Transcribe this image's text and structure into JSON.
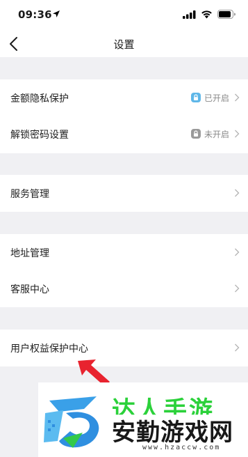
{
  "status_bar": {
    "time": "09:36"
  },
  "nav": {
    "title": "设置"
  },
  "settings": {
    "privacy": {
      "label": "金额隐私保护",
      "status": "已开启"
    },
    "unlock_password": {
      "label": "解锁密码设置",
      "status": "未开启"
    },
    "service_management": {
      "label": "服务管理"
    },
    "address_management": {
      "label": "地址管理"
    },
    "customer_service": {
      "label": "客服中心"
    },
    "user_rights": {
      "label": "用户权益保护中心"
    }
  },
  "colors": {
    "enabled_lock": "#5fb7e8",
    "disabled_lock": "#9a9a9a",
    "arrow": "#e8232f",
    "watermark_green": "#2bd13a"
  },
  "watermark": {
    "top_text": "达人手游",
    "main_text": "安勤游戏网",
    "url": "www.hzaccw.com"
  }
}
